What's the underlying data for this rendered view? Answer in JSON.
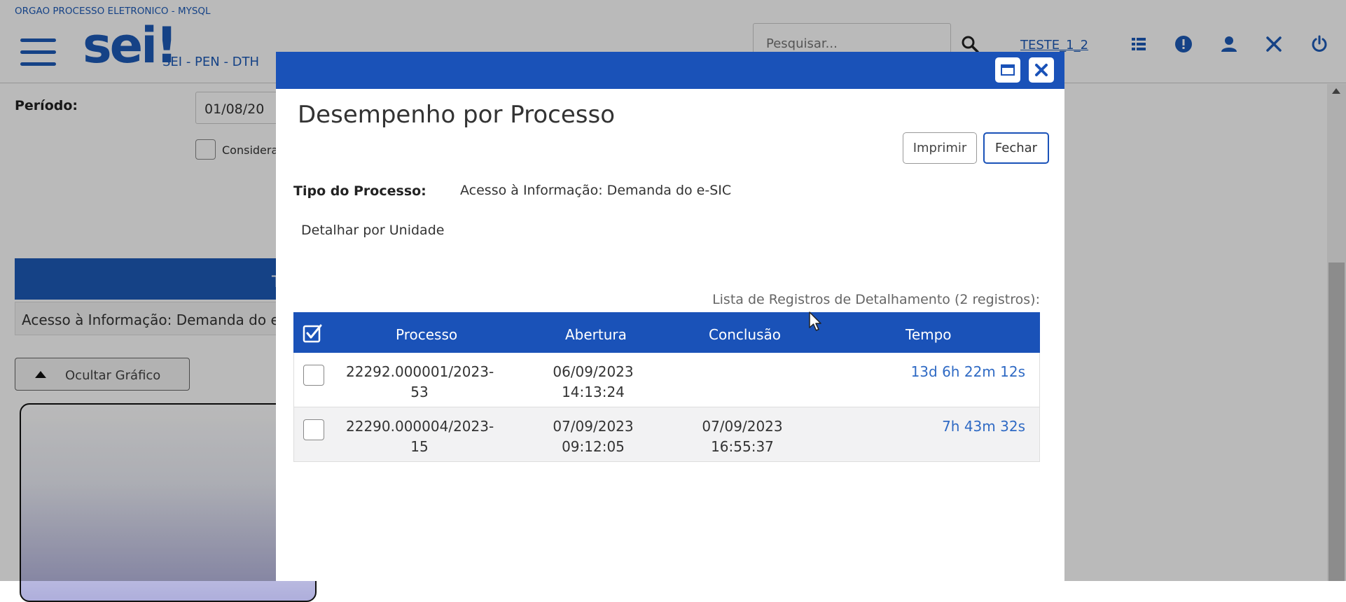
{
  "app": {
    "org_title": "ORGAO PROCESSO ELETRONICO - MYSQL",
    "logo_text": "sei!",
    "logo_subtitle": "SEI - PEN - DTH",
    "search_placeholder": "Pesquisar...",
    "user": "TESTE_1_2",
    "top_icons": [
      "menu-icon",
      "hamburger-icon",
      "search-icon",
      "list-icon",
      "alert-icon",
      "user-icon",
      "tools-icon",
      "power-icon"
    ]
  },
  "background": {
    "periodo_label": "Período:",
    "date_value": "01/08/20",
    "checkbox_label": "Considera",
    "table_header_fragment": "T",
    "row_text": "Acesso à Informação: Demanda do e-",
    "toggle_chart_label": "Ocultar Gráfico"
  },
  "modal": {
    "title": "Desempenho por Processo",
    "print_label": "Imprimir",
    "close_label": "Fechar",
    "tipo_label": "Tipo do Processo:",
    "tipo_value": "Acesso à Informação: Demanda do e-SIC",
    "detalhar_label": "Detalhar por Unidade",
    "caption": "Lista de Registros de Detalhamento (2 registros):",
    "columns": [
      "Processo",
      "Abertura",
      "Conclusão",
      "Tempo"
    ],
    "rows": [
      {
        "processo_1": "22292.000001/2023-",
        "processo_2": "53",
        "abertura_1": "06/09/2023",
        "abertura_2": "14:13:24",
        "conclusao_1": "",
        "conclusao_2": "",
        "tempo": "13d 6h 22m 12s"
      },
      {
        "processo_1": "22290.000004/2023-",
        "processo_2": "15",
        "abertura_1": "07/09/2023",
        "abertura_2": "09:12:05",
        "conclusao_1": "07/09/2023",
        "conclusao_2": "16:55:37",
        "tempo": "7h 43m 32s"
      }
    ]
  },
  "colors": {
    "primary": "#1a52b8",
    "link": "#2f6ac4",
    "overlay": "rgba(0,0,0,0.27)"
  }
}
